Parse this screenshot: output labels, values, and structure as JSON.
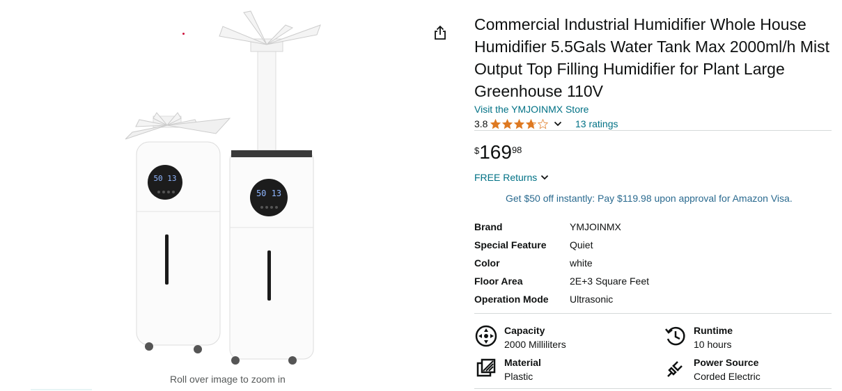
{
  "product": {
    "title": "Commercial Industrial Humidifier Whole House Humidifier 5.5Gals Water Tank Max 2000ml/h Mist Output Top Filling Humidifier for Plant Large Greenhouse 110V",
    "store_link": "Visit the YMJOINMX Store",
    "rating": "3.8",
    "ratings_count": "13 ratings",
    "stars": 3.8
  },
  "price": {
    "symbol": "$",
    "whole": "169",
    "fraction": "98"
  },
  "returns": {
    "label": "FREE Returns"
  },
  "promo": {
    "text": "Get $50 off instantly: Pay $119.98 upon approval for Amazon Visa."
  },
  "gallery": {
    "zoom_hint": "Roll over image to zoom in",
    "display_text": "50 13"
  },
  "specs": [
    {
      "key": "Brand",
      "value": "YMJOINMX"
    },
    {
      "key": "Special Feature",
      "value": "Quiet"
    },
    {
      "key": "Color",
      "value": "white"
    },
    {
      "key": "Floor Area",
      "value": "2E+3 Square Feet"
    },
    {
      "key": "Operation Mode",
      "value": "Ultrasonic"
    }
  ],
  "features": [
    {
      "title": "Capacity",
      "value": "2000 Milliliters",
      "icon": "capacity-icon"
    },
    {
      "title": "Runtime",
      "value": "10 hours",
      "icon": "runtime-icon"
    },
    {
      "title": "Material",
      "value": "Plastic",
      "icon": "material-icon"
    },
    {
      "title": "Power Source",
      "value": "Corded Electric",
      "icon": "power-source-icon"
    }
  ],
  "colors": {
    "link": "#007185",
    "star": "#de7921",
    "text": "#0f1111"
  }
}
